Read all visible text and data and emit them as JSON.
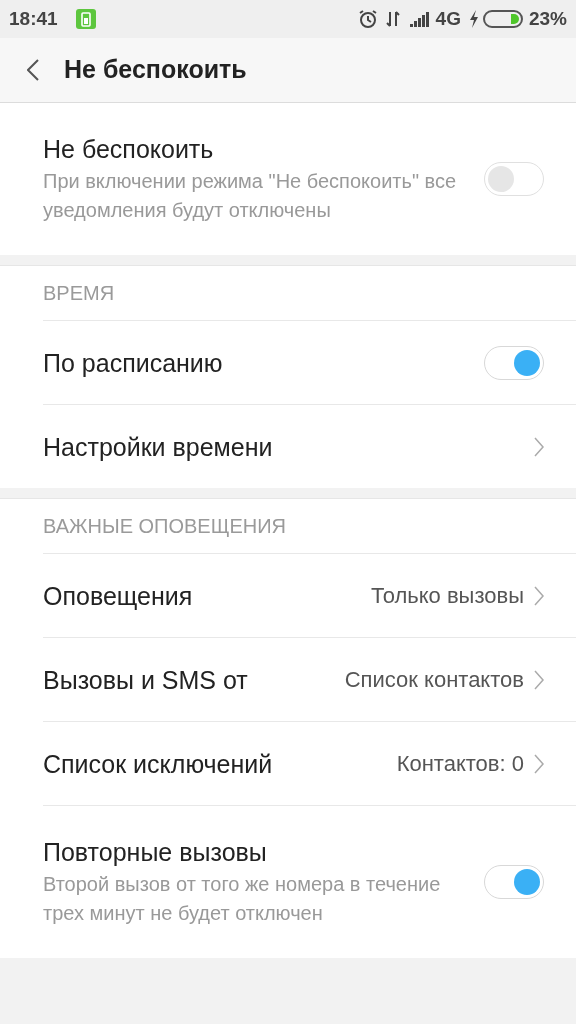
{
  "status_bar": {
    "time": "18:41",
    "network": "4G",
    "battery": "23%"
  },
  "header": {
    "title": "Не беспокоить"
  },
  "sections": [
    {
      "items": [
        {
          "kind": "toggle",
          "title": "Не беспокоить",
          "subtitle": "При включении режима \"Не беспокоить\" все уведомления будут отключены",
          "on": false
        }
      ]
    },
    {
      "title": "ВРЕМЯ",
      "items": [
        {
          "kind": "toggle",
          "title": "По расписанию",
          "on": true
        },
        {
          "kind": "link",
          "title": "Настройки времени"
        }
      ]
    },
    {
      "title": "ВАЖНЫЕ ОПОВЕЩЕНИЯ",
      "items": [
        {
          "kind": "link",
          "title": "Оповещения",
          "value": "Только вызовы"
        },
        {
          "kind": "link",
          "title": "Вызовы и SMS от",
          "value": "Список контактов"
        },
        {
          "kind": "link",
          "title": "Список исключений",
          "value": "Контактов: 0"
        },
        {
          "kind": "toggle",
          "title": "Повторные вызовы",
          "subtitle": "Второй вызов от того же номера в течение трех минут не будет отключен",
          "on": true
        }
      ]
    }
  ]
}
